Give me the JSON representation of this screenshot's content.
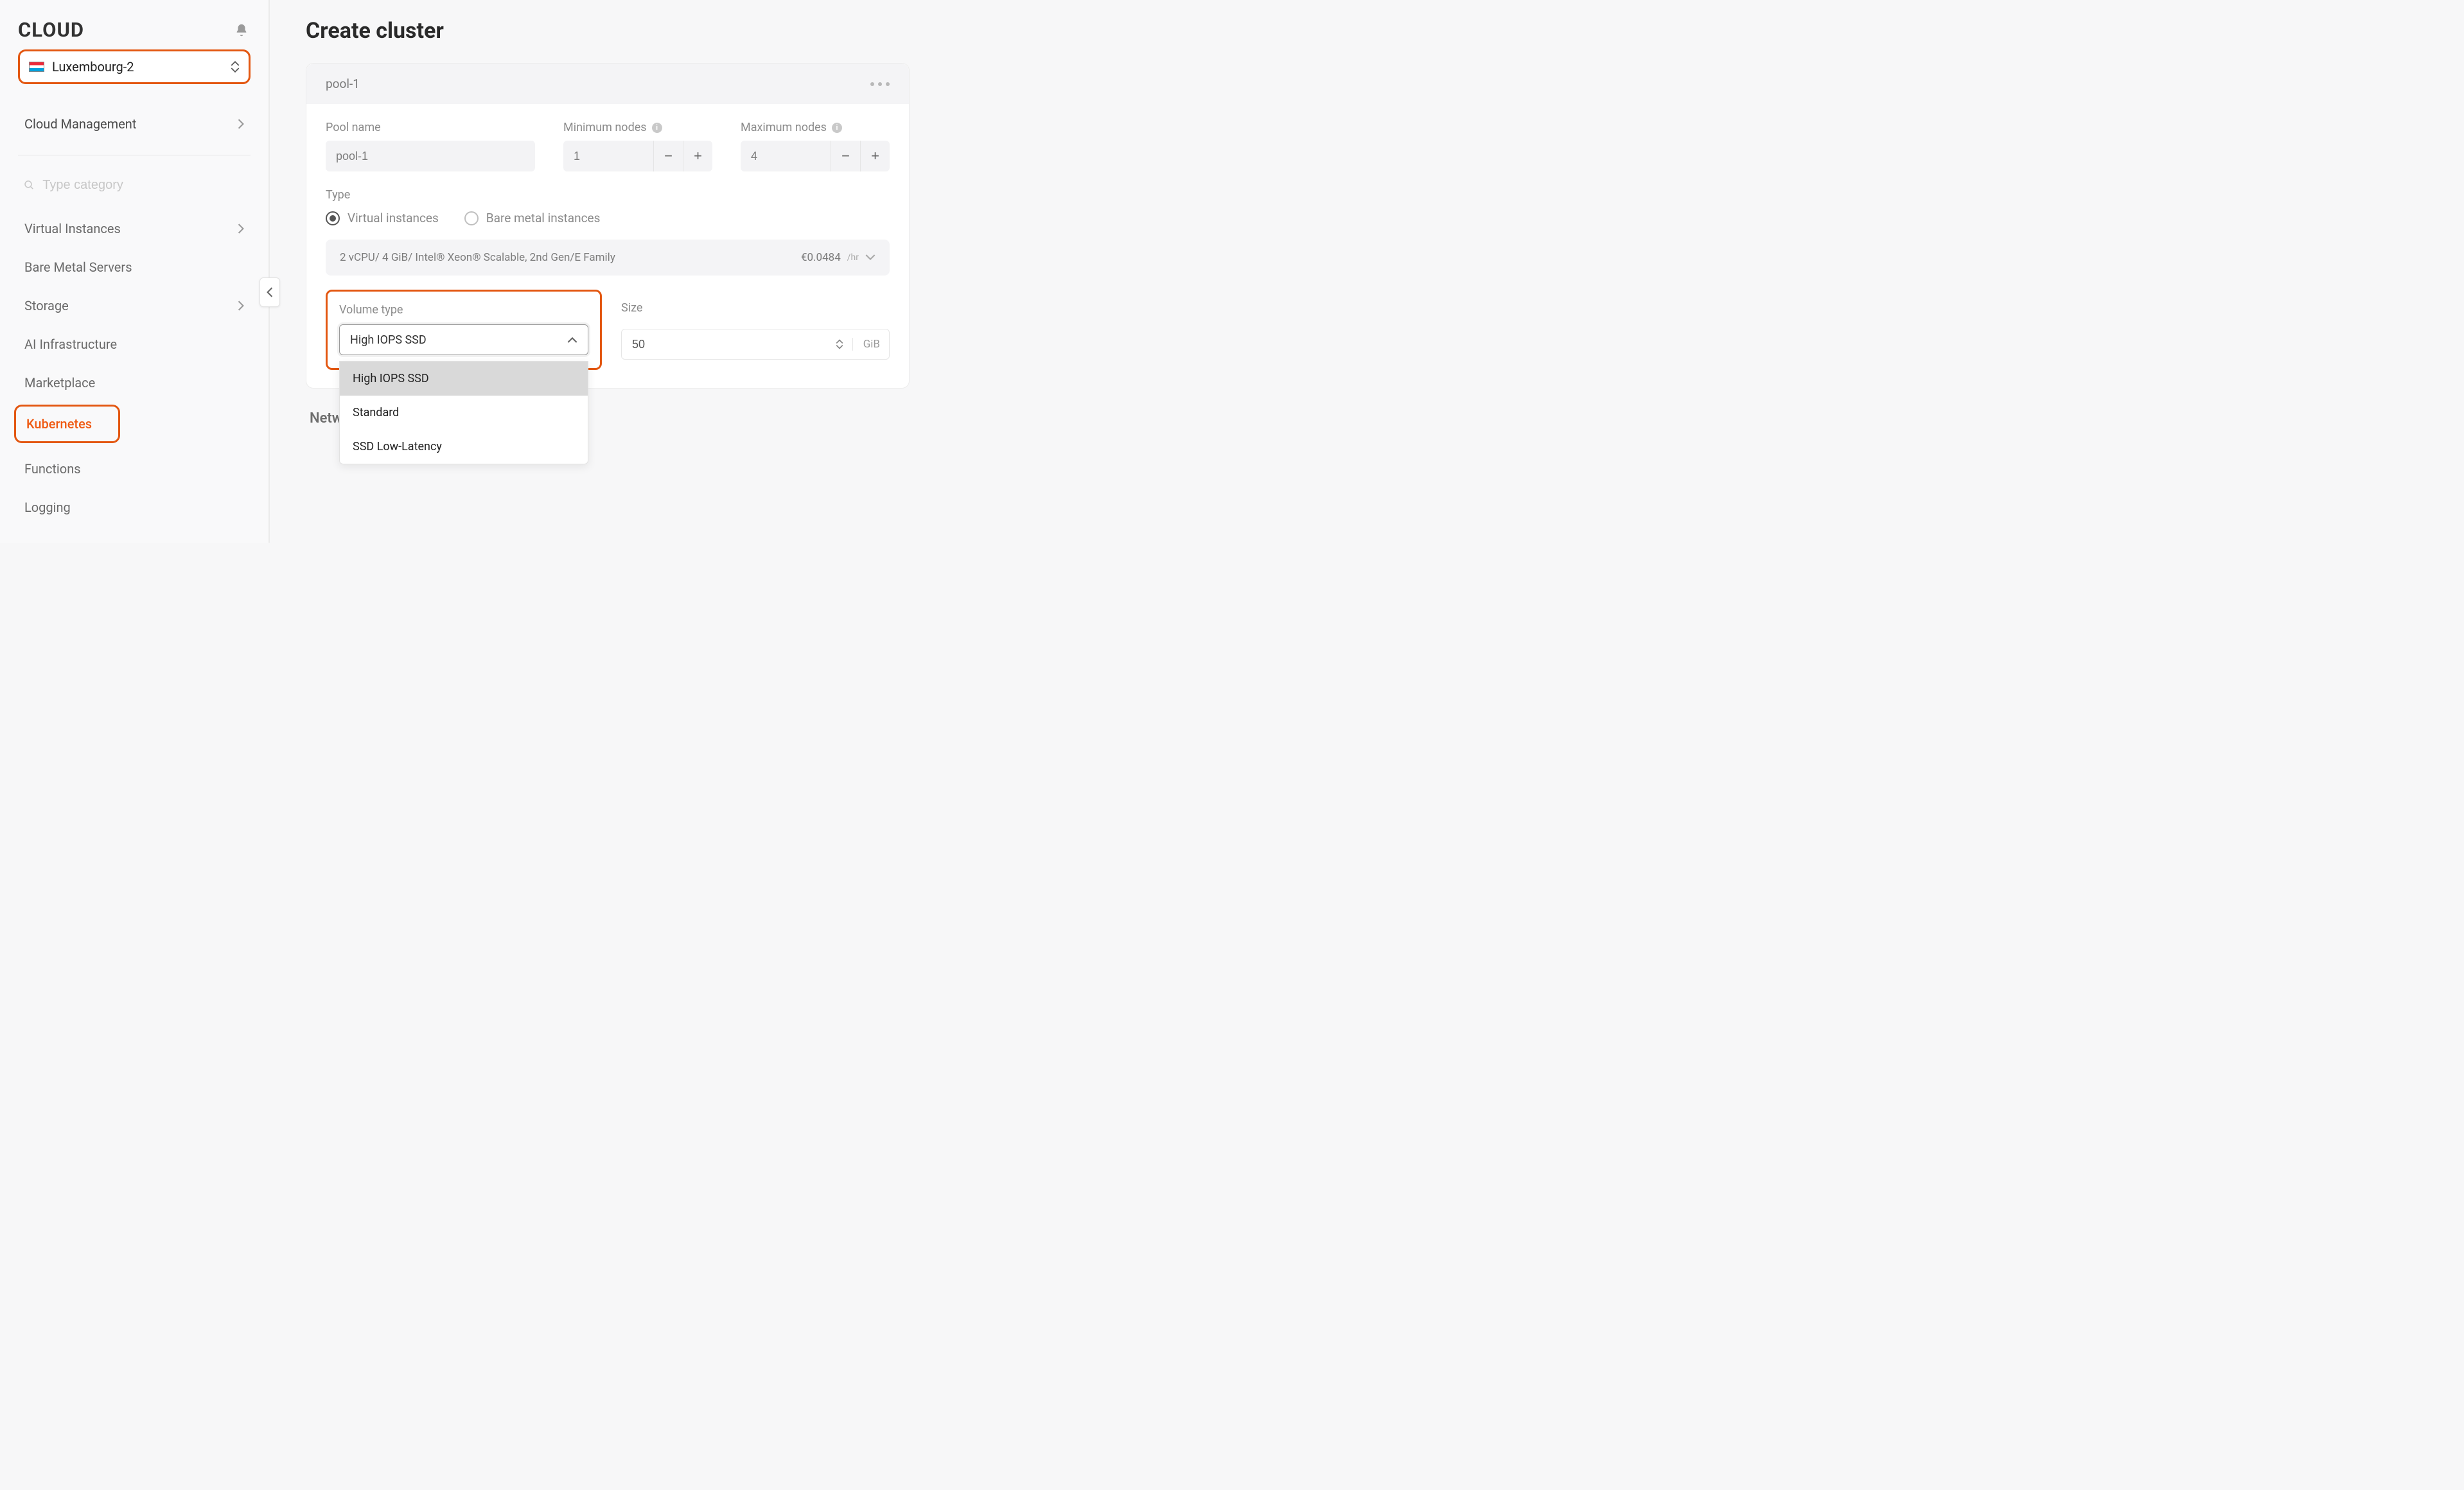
{
  "brand": "CLOUD",
  "region": {
    "country": "Luxembourg",
    "label": "Luxembourg-2"
  },
  "sidebar": {
    "top_item": {
      "label": "Cloud Management"
    },
    "search_placeholder": "Type category",
    "items": [
      {
        "label": "Virtual Instances",
        "chevron": true
      },
      {
        "label": "Bare Metal Servers",
        "chevron": false
      },
      {
        "label": "Storage",
        "chevron": true
      },
      {
        "label": "AI Infrastructure",
        "chevron": false
      },
      {
        "label": "Marketplace",
        "chevron": false
      },
      {
        "label": "Kubernetes",
        "chevron": false,
        "active": true
      },
      {
        "label": "Functions",
        "chevron": false
      },
      {
        "label": "Logging",
        "chevron": false
      }
    ]
  },
  "page": {
    "title": "Create cluster"
  },
  "pool": {
    "header_name": "pool-1",
    "fields": {
      "pool_name": {
        "label": "Pool name",
        "value": "pool-1"
      },
      "min_nodes": {
        "label": "Minimum nodes",
        "value": "1"
      },
      "max_nodes": {
        "label": "Maximum nodes",
        "value": "4"
      }
    },
    "type": {
      "label": "Type",
      "options": [
        {
          "label": "Virtual instances",
          "selected": true
        },
        {
          "label": "Bare metal instances",
          "selected": false
        }
      ]
    },
    "hardware": {
      "spec": "2 vCPU/ 4 GiB/ Intel® Xeon® Scalable, 2nd Gen/E Family",
      "price": "€0.0484",
      "per": "/hr"
    },
    "volume": {
      "label": "Volume type",
      "selected": "High IOPS SSD",
      "options": [
        "High IOPS SSD",
        "Standard",
        "SSD Low-Latency"
      ]
    },
    "size": {
      "label": "Size",
      "value": "50",
      "unit": "GiB"
    }
  },
  "network": {
    "title": "Network settings"
  }
}
